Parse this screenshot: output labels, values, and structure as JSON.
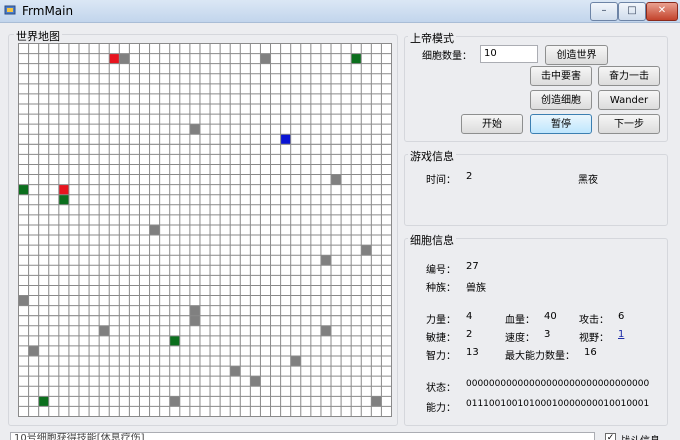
{
  "window": {
    "title": "FrmMain",
    "min": "–",
    "max": "□",
    "close": "✕"
  },
  "map": {
    "label": "世界地图",
    "cols": 37,
    "rows": 37,
    "colors": {
      "grid": "#8a8a8a",
      "empty": "#ffffff",
      "gray": "#808080",
      "red": "#e8141e",
      "green": "#0b6f1d",
      "blue": "#0a14d4"
    },
    "cells": [
      [
        9,
        1,
        "red"
      ],
      [
        10,
        1,
        "gray"
      ],
      [
        24,
        1,
        "gray"
      ],
      [
        33,
        1,
        "green"
      ],
      [
        17,
        8,
        "gray"
      ],
      [
        26,
        9,
        "blue"
      ],
      [
        31,
        13,
        "gray"
      ],
      [
        0,
        14,
        "green"
      ],
      [
        4,
        14,
        "red"
      ],
      [
        4,
        15,
        "green"
      ],
      [
        13,
        18,
        "gray"
      ],
      [
        34,
        20,
        "gray"
      ],
      [
        30,
        21,
        "gray"
      ],
      [
        0,
        25,
        "gray"
      ],
      [
        17,
        26,
        "gray"
      ],
      [
        17,
        27,
        "gray"
      ],
      [
        8,
        28,
        "gray"
      ],
      [
        30,
        28,
        "gray"
      ],
      [
        15,
        29,
        "green"
      ],
      [
        1,
        30,
        "gray"
      ],
      [
        27,
        31,
        "gray"
      ],
      [
        21,
        32,
        "gray"
      ],
      [
        23,
        33,
        "gray"
      ],
      [
        2,
        35,
        "green"
      ],
      [
        15,
        35,
        "gray"
      ],
      [
        35,
        35,
        "gray"
      ],
      [
        5,
        38,
        "green"
      ],
      [
        27,
        39,
        "gray"
      ]
    ]
  },
  "god_mode": {
    "title": "上帝模式",
    "cell_count_label": "细胞数量：",
    "cell_count_value": "10",
    "create_world": "创造世界",
    "smite": "击中要害",
    "strike": "奋力一击",
    "create_cell": "创造细胞",
    "wander": "Wander",
    "start": "开始",
    "pause": "暂停",
    "next_step": "下一步"
  },
  "game_info": {
    "title": "游戏信息",
    "time_label": "时间：",
    "time_value": "2",
    "period": "黑夜"
  },
  "cell_info": {
    "title": "细胞信息",
    "id_label": "编号：",
    "id_value": "27",
    "race_label": "种族：",
    "race_value": "兽族",
    "strength_label": "力量：",
    "strength_value": "4",
    "hp_label": "血量：",
    "hp_value": "40",
    "attack_label": "攻击：",
    "attack_value": "6",
    "agility_label": "敏捷：",
    "agility_value": "2",
    "speed_label": "速度：",
    "speed_value": "3",
    "vision_label": "视野：",
    "vision_value": "1",
    "intelligence_label": "智力：",
    "intelligence_value": "13",
    "max_ability_label": "最大能力数量：",
    "max_ability_value": "16",
    "state_label": "状态：",
    "state_value": "00000000000000000000000000000000",
    "ability_label": "能力：",
    "ability_value": "01110010010100010000000010010001"
  },
  "status": {
    "log_text": "10号细胞获得技能[休息疗伤]",
    "battle_checkbox_label": "战斗信息"
  }
}
